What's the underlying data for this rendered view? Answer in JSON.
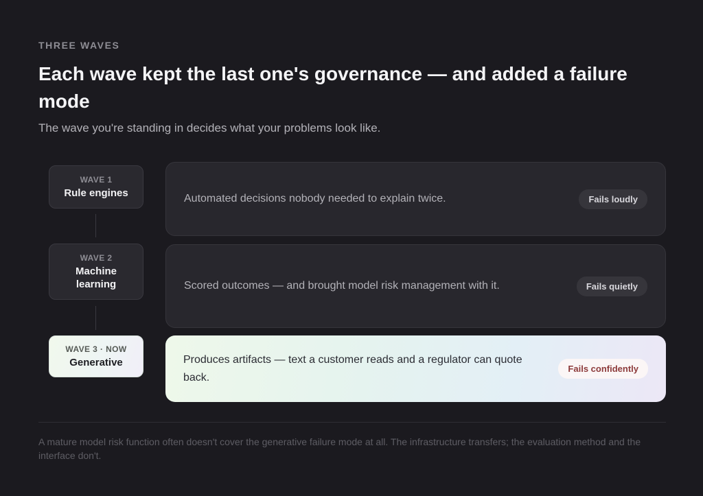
{
  "header": {
    "eyebrow": "THREE WAVES",
    "title": "Each wave kept the last one's governance — and added a failure mode",
    "subtitle": "The wave you're standing in decides what your problems look like."
  },
  "waves": [
    {
      "tag": "WAVE 1",
      "name": "Rule engines",
      "description": "Automated decisions nobody needed to explain twice.",
      "badge": "Fails loudly"
    },
    {
      "tag": "WAVE 2",
      "name": "Machine learning",
      "description": "Scored outcomes — and brought model risk management with it.",
      "badge": "Fails quietly"
    },
    {
      "tag": "WAVE 3 · NOW",
      "name": "Generative",
      "description": "Produces artifacts — text a customer reads and a regulator can quote back.",
      "badge": "Fails confidently"
    }
  ],
  "footnote": "A mature model risk function often doesn't cover the generative failure mode at all. The infrastructure transfers; the evaluation method and the interface don't.",
  "colors": {
    "background": "#1b1a1f",
    "card": "#28272d",
    "highlight_badge_text": "#8c3a3a"
  }
}
